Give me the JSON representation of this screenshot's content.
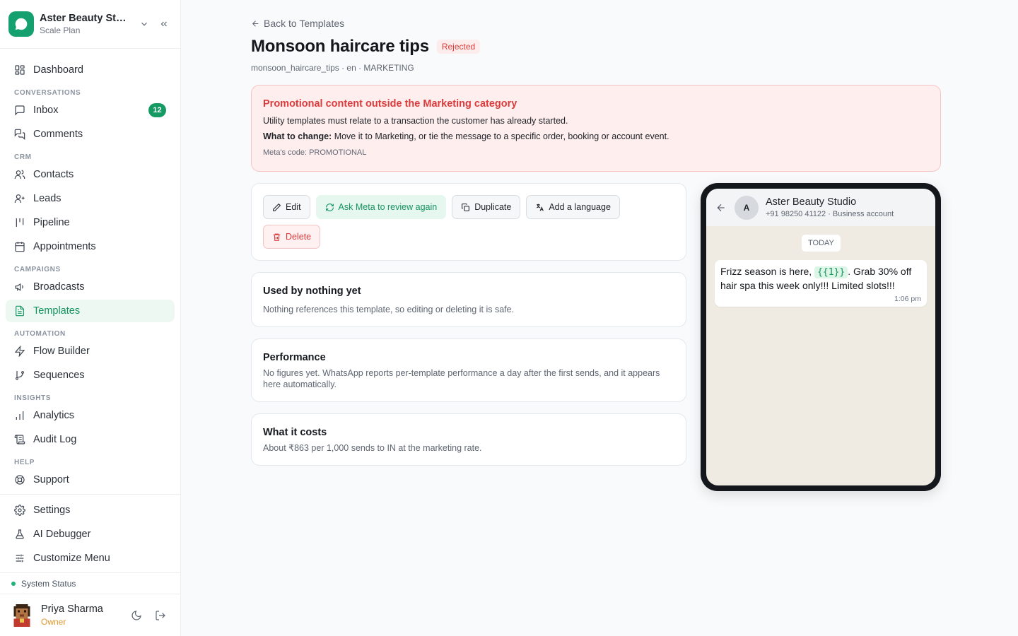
{
  "workspace": {
    "name": "Aster Beauty Stu...",
    "plan": "Scale Plan"
  },
  "nav": {
    "dashboard": "Dashboard",
    "sections": {
      "conversations": "CONVERSATIONS",
      "crm": "CRM",
      "campaigns": "CAMPAIGNS",
      "automation": "AUTOMATION",
      "insights": "INSIGHTS",
      "help": "HELP"
    },
    "inbox": "Inbox",
    "inbox_count": "12",
    "comments": "Comments",
    "contacts": "Contacts",
    "leads": "Leads",
    "pipeline": "Pipeline",
    "appointments": "Appointments",
    "broadcasts": "Broadcasts",
    "templates": "Templates",
    "flow_builder": "Flow Builder",
    "sequences": "Sequences",
    "analytics": "Analytics",
    "audit_log": "Audit Log",
    "support": "Support",
    "settings": "Settings",
    "ai_debugger": "AI Debugger",
    "customize_menu": "Customize Menu"
  },
  "system_status": "System Status",
  "user": {
    "name": "Priya Sharma",
    "role": "Owner"
  },
  "page": {
    "back_label": "Back to Templates",
    "title": "Monsoon haircare tips",
    "status": "Rejected",
    "meta": "monsoon_haircare_tips · en · MARKETING"
  },
  "alert": {
    "title": "Promotional content outside the Marketing category",
    "body": "Utility templates must relate to a transaction the customer has already started.",
    "change_label": "What to change:",
    "change_text": " Move it to Marketing, or tie the message to a specific order, booking or account event.",
    "code": "Meta's code: PROMOTIONAL"
  },
  "actions": {
    "edit": "Edit",
    "review": "Ask Meta to review again",
    "duplicate": "Duplicate",
    "add_language": "Add a language",
    "delete": "Delete"
  },
  "usage": {
    "title": "Used by nothing yet",
    "text": "Nothing references this template, so editing or deleting it is safe."
  },
  "performance": {
    "title": "Performance",
    "text": "No figures yet. WhatsApp reports per-template performance a day after the first sends, and it appears here automatically."
  },
  "costs": {
    "title": "What it costs",
    "text": "About ₹863 per 1,000 sends to IN at the marketing rate."
  },
  "preview": {
    "avatar_letter": "A",
    "name": "Aster Beauty Studio",
    "sub": "+91 98250 41122 · Business account",
    "day": "TODAY",
    "msg_before": "Frizz season is here, ",
    "variable": "{{1}}",
    "msg_after": ". Grab 30% off hair spa this week only!!! Limited slots!!!",
    "time": "1:06 pm"
  },
  "colors": {
    "brand": "#14a06f",
    "danger": "#dc3b3b",
    "chat_bg": "#efeae2"
  }
}
